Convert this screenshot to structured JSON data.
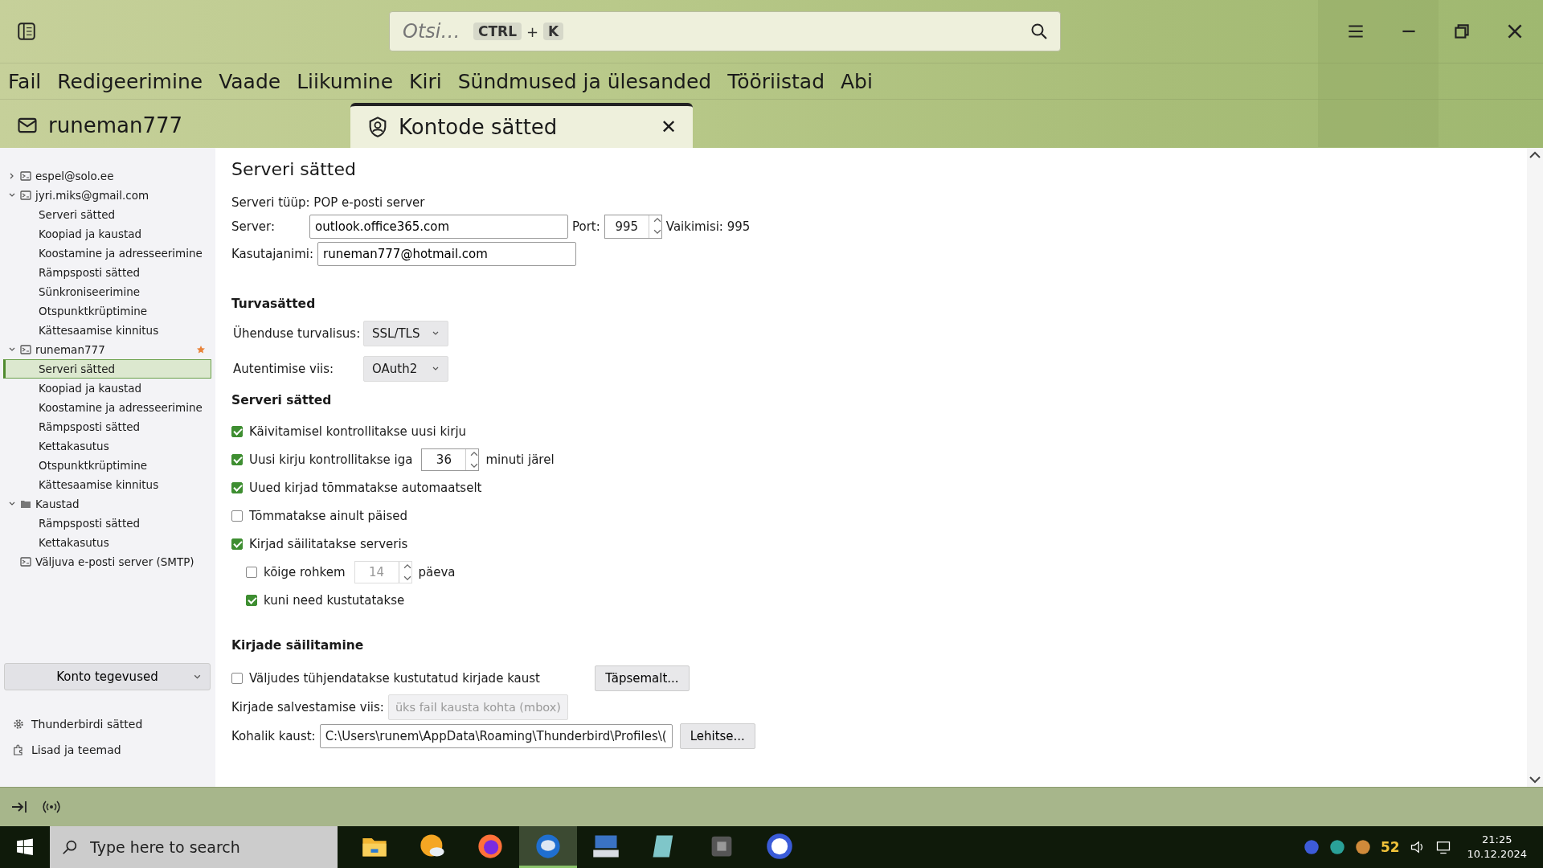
{
  "search": {
    "placeholder": "Otsi…",
    "keys": [
      "CTRL",
      "K"
    ],
    "plus": "+"
  },
  "menu": [
    "Fail",
    "Redigeerimine",
    "Vaade",
    "Liikumine",
    "Kiri",
    "Sündmused ja ülesanded",
    "Tööriistad",
    "Abi"
  ],
  "tabs": [
    {
      "label": "runeman777",
      "kind": "mail",
      "selected": false,
      "closable": false
    },
    {
      "label": "Kontode sätted",
      "kind": "accounts",
      "selected": true,
      "closable": true
    }
  ],
  "close_glyph": "✕",
  "sidebar": {
    "accounts": [
      {
        "label": "espel@solo.ee",
        "kind": "account",
        "expanded": false,
        "starred": false,
        "selected": false
      },
      {
        "label": "jyri.miks@gmail.com",
        "kind": "account",
        "expanded": true,
        "starred": false,
        "selected": false,
        "children": [
          {
            "label": "Serveri sätted",
            "selected": false
          },
          {
            "label": "Koopiad ja kaustad",
            "selected": false
          },
          {
            "label": "Koostamine ja adresseerimine",
            "selected": false
          },
          {
            "label": "Rämpsposti sätted",
            "selected": false
          },
          {
            "label": "Sünkroniseerimine",
            "selected": false
          },
          {
            "label": "Otspunktkrüptimine",
            "selected": false
          },
          {
            "label": "Kättesaamise kinnitus",
            "selected": false
          }
        ]
      },
      {
        "label": "runeman777",
        "kind": "account",
        "expanded": true,
        "starred": true,
        "selected": false,
        "children": [
          {
            "label": "Serveri sätted",
            "selected": true
          },
          {
            "label": "Koopiad ja kaustad",
            "selected": false
          },
          {
            "label": "Koostamine ja adresseerimine",
            "selected": false
          },
          {
            "label": "Rämpsposti sätted",
            "selected": false
          },
          {
            "label": "Kettakasutus",
            "selected": false
          },
          {
            "label": "Otspunktkrüptimine",
            "selected": false
          },
          {
            "label": "Kättesaamise kinnitus",
            "selected": false
          }
        ]
      },
      {
        "label": "Kaustad",
        "kind": "folder",
        "expanded": true,
        "starred": false,
        "selected": false,
        "children": [
          {
            "label": "Rämpsposti sätted",
            "selected": false
          },
          {
            "label": "Kettakasutus",
            "selected": false
          }
        ]
      },
      {
        "label": "Väljuva e-posti server (SMTP)",
        "kind": "smtp",
        "starred": false,
        "selected": false
      }
    ],
    "actions_button": "Konto tegevused",
    "footer_links": [
      {
        "label": "Thunderbirdi sätted",
        "kind": "settings"
      },
      {
        "label": "Lisad ja teemad",
        "kind": "addons"
      }
    ]
  },
  "main": {
    "title": "Serveri sätted",
    "server_type": "Serveri tüüp: POP e-posti server",
    "server_label": "Server:",
    "server_value": "outlook.office365.com",
    "port_label": "Port:",
    "port_value": "995",
    "port_default": "Vaikimisi: 995",
    "user_label": "Kasutajanimi:",
    "user_value": "runeman777@hotmail.com",
    "security_heading": "Turvasätted",
    "selects": [
      {
        "label": "Ühenduse turvalisus:",
        "value": "SSL/TLS"
      },
      {
        "label": "Autentimise viis:",
        "value": "OAuth2"
      }
    ],
    "server_heading": "Serveri sätted",
    "options": [
      {
        "kind": "check",
        "label": "Käivitamisel kontrollitakse uusi kirju",
        "checked": true
      },
      {
        "kind": "spin",
        "label": "Uusi kirju kontrollitakse iga",
        "value": "36",
        "suffix": "minuti järel",
        "checked": true,
        "disabled": false
      },
      {
        "kind": "check",
        "label": "Uued kirjad tõmmatakse automaatselt",
        "checked": true
      },
      {
        "kind": "check",
        "label": "Tõmmatakse ainult päised",
        "checked": false
      },
      {
        "kind": "check",
        "label": "Kirjad säilitatakse serveris",
        "checked": true,
        "children": [
          {
            "kind": "spin",
            "label": "kõige rohkem",
            "value": "14",
            "suffix": "päeva",
            "checked": false,
            "disabled": true
          },
          {
            "kind": "check",
            "label": "kuni need kustutatakse",
            "checked": true
          }
        ]
      }
    ],
    "storage_heading": "Kirjade säilitamine",
    "empty_trash": {
      "label": "Väljudes tühjendatakse kustutatud kirjade kaust",
      "checked": false
    },
    "advanced_button": "Täpsemalt...",
    "store_label": "Kirjade salvestamise viis:",
    "store_value": "üks fail kausta kohta (mbox)",
    "store_disabled": true,
    "local_label": "Kohalik kaust:",
    "local_value": "C:\\Users\\runem\\AppData\\Roaming\\Thunderbird\\Profiles\\(",
    "browse_button": "Lehitse..."
  },
  "taskbar": {
    "search_placeholder": "Type here to search",
    "apps": [
      {
        "kind": "folder",
        "selected": false
      },
      {
        "kind": "weather",
        "selected": false
      },
      {
        "kind": "browser",
        "selected": false
      },
      {
        "kind": "mail",
        "selected": true
      },
      {
        "kind": "keyboard",
        "selected": false
      },
      {
        "kind": "notes",
        "selected": false
      },
      {
        "kind": "box",
        "selected": false
      },
      {
        "kind": "chat",
        "selected": false
      }
    ],
    "battery": "52",
    "time": "21:25",
    "date": "10.12.2024"
  }
}
